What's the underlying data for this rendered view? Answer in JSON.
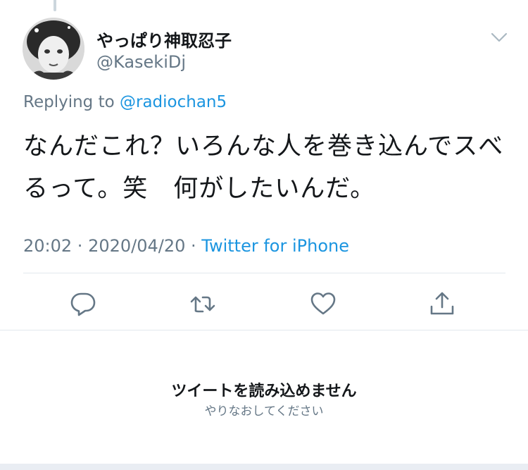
{
  "tweet": {
    "display_name": "やっぱり神取忍子",
    "handle": "@KasekiDj",
    "replying_prefix": "Replying to ",
    "replying_to": "@radiochan5",
    "text": "なんだこれ？いろんな人を巻き込んでスべるって。笑　何がしたいんだ。",
    "time": "20:02",
    "date": "2020/04/20",
    "separator": " · ",
    "source": "Twitter for iPhone",
    "icons": {
      "caret": "chevron-down-icon",
      "reply": "reply-icon",
      "retweet": "retweet-icon",
      "like": "heart-icon",
      "share": "share-icon"
    }
  },
  "error": {
    "title": "ツイートを読み込めません",
    "retry": "やりなおしてください"
  },
  "colors": {
    "link": "#1b95e0",
    "secondary": "#657786",
    "text": "#14171a",
    "icon": "#657786",
    "divider": "#e1e8ed"
  }
}
